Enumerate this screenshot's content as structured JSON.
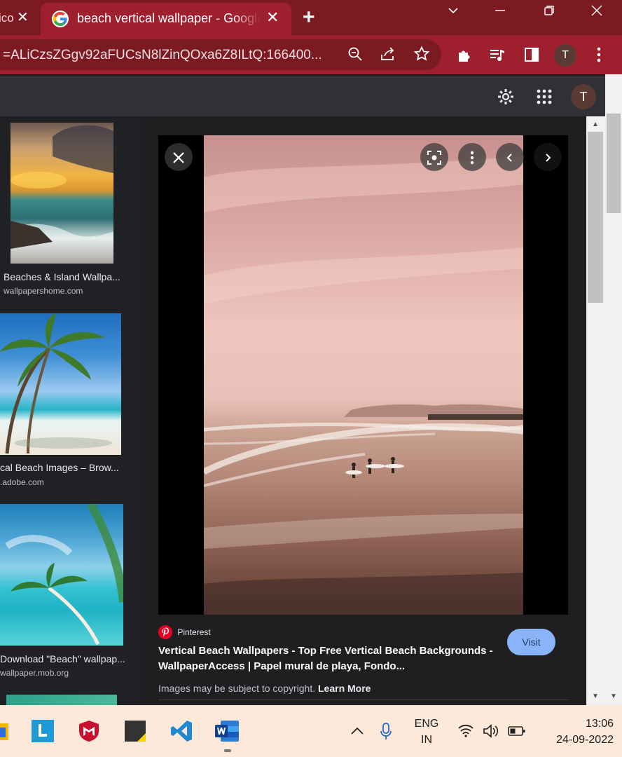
{
  "browser": {
    "prev_tab_fragment": "ico",
    "active_tab_title": "beach vertical wallpaper - Google Search",
    "url": "=ALiCzsZGgv92aFUCsN8lZinQOxa6Z8ILtQ:166400...",
    "profile_initial": "T",
    "colors": {
      "tab_strip": "#7c1a22",
      "toolbar": "#9e1f2d"
    }
  },
  "page": {
    "profile_initial": "T",
    "left_results": [
      {
        "caption": "Beaches & Island Wallpa...",
        "source": "wallpapershome.com"
      },
      {
        "caption": "cal Beach Images – Brow...",
        "source": ".adobe.com"
      },
      {
        "caption": "Download \"Beach\" wallpap...",
        "source": "wallpaper.mob.org"
      }
    ],
    "viewer": {
      "source_name": "Pinterest",
      "title": "Vertical Beach Wallpapers - Top Free Vertical Beach Backgrounds - WallpaperAccess | Papel mural de playa, Fondo...",
      "copyright_text": "Images may be subject to copyright.",
      "learn_more": "Learn More",
      "visit_label": "Visit"
    }
  },
  "taskbar": {
    "language_top": "ENG",
    "language_bottom": "IN",
    "time": "13:06",
    "date": "24-09-2022"
  }
}
